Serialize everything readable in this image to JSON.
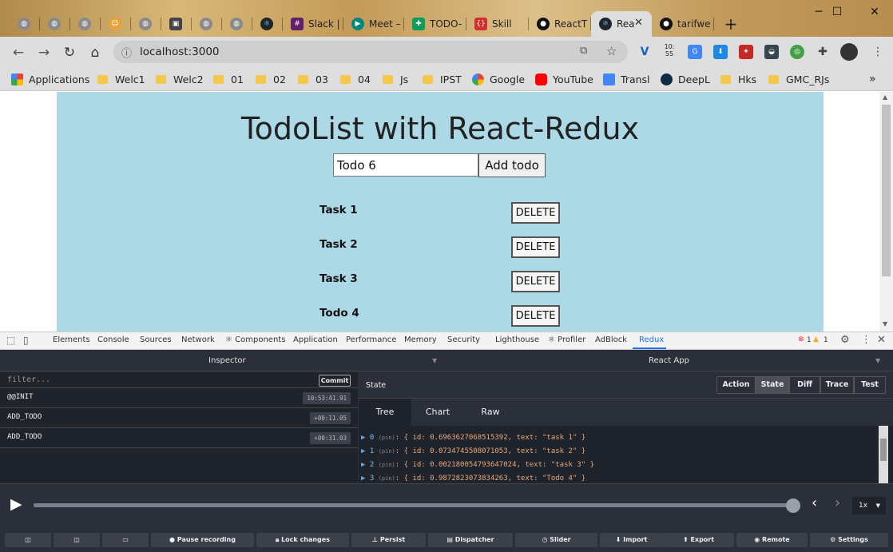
{
  "browser": {
    "tabs": [
      {
        "label": ""
      },
      {
        "label": ""
      },
      {
        "label": ""
      },
      {
        "label": ""
      },
      {
        "label": ""
      },
      {
        "label": ""
      },
      {
        "label": ""
      },
      {
        "label": ""
      },
      {
        "label": ""
      },
      {
        "label": "Slack |"
      },
      {
        "label": "Meet –"
      },
      {
        "label": "TODO-"
      },
      {
        "label": "Skill"
      },
      {
        "label": "ReactT"
      },
      {
        "label": "Rea"
      },
      {
        "label": "tarifwe"
      }
    ],
    "new_tab": "+",
    "url": "localhost:3000",
    "bookmarks": [
      {
        "label": "Applications"
      },
      {
        "label": "Welc1"
      },
      {
        "label": "Welc2"
      },
      {
        "label": "01"
      },
      {
        "label": "02"
      },
      {
        "label": "03"
      },
      {
        "label": "04"
      },
      {
        "label": "Js"
      },
      {
        "label": "IPST"
      },
      {
        "label": "Google"
      },
      {
        "label": "YouTube"
      },
      {
        "label": "Transl"
      },
      {
        "label": "DeepL"
      },
      {
        "label": "Hks"
      },
      {
        "label": "GMC_RJs"
      }
    ],
    "clock_ext": "10:\n55",
    "accent": "#1a73e8"
  },
  "app": {
    "title": "TodoList with React-Redux",
    "input_value": "Todo 6",
    "add_label": "Add todo",
    "delete_label": "DELETE",
    "tasks": [
      {
        "name": "Task 1"
      },
      {
        "name": "Task 2"
      },
      {
        "name": "Task 3"
      },
      {
        "name": "Todo 4"
      }
    ],
    "background": "#add8e6"
  },
  "devtools": {
    "tabs": [
      "Elements",
      "Console",
      "Sources",
      "Network",
      "⚛ Components",
      "Application",
      "Performance",
      "Memory",
      "Security",
      "Lighthouse",
      "⚛ Profiler",
      "AdBlock",
      "Redux"
    ],
    "errors": "1",
    "warnings": "1",
    "redux": {
      "inspector_label": "Inspector",
      "instance_label": "React App",
      "filter_placeholder": "filter...",
      "commit_label": "Commit",
      "actions": [
        {
          "name": "@@INIT",
          "time": "10:53:41.91"
        },
        {
          "name": "ADD_TODO",
          "time": "+00:11.05"
        },
        {
          "name": "ADD_TODO",
          "time": "+00:31.03"
        }
      ],
      "state_label": "State",
      "mode_buttons": [
        "Action",
        "State",
        "Diff",
        "Trace",
        "Test"
      ],
      "active_mode": "State",
      "subtabs": [
        "Tree",
        "Chart",
        "Raw"
      ],
      "state_rows": [
        {
          "idx": "0",
          "pin": "(pin)",
          "text": ": { id: 0.6963627068515392, text: \"task 1\" }"
        },
        {
          "idx": "1",
          "pin": "(pin)",
          "text": ": { id: 0.0734745508071053, text: \"task 2\" }"
        },
        {
          "idx": "2",
          "pin": "(pin)",
          "text": ": { id: 0.002180054793647024, text: \"task 3\" }"
        },
        {
          "idx": "3",
          "pin": "(pin)",
          "text": ": { id: 0.9872823073834263, text: \"Todo 4\" }"
        }
      ],
      "speed": "1x",
      "bottom_buttons": [
        "",
        "",
        "",
        "Pause recording",
        "Lock changes",
        "Persist",
        "Dispatcher",
        "Slider",
        "Import",
        "Export",
        "Remote",
        "Settings"
      ]
    }
  }
}
